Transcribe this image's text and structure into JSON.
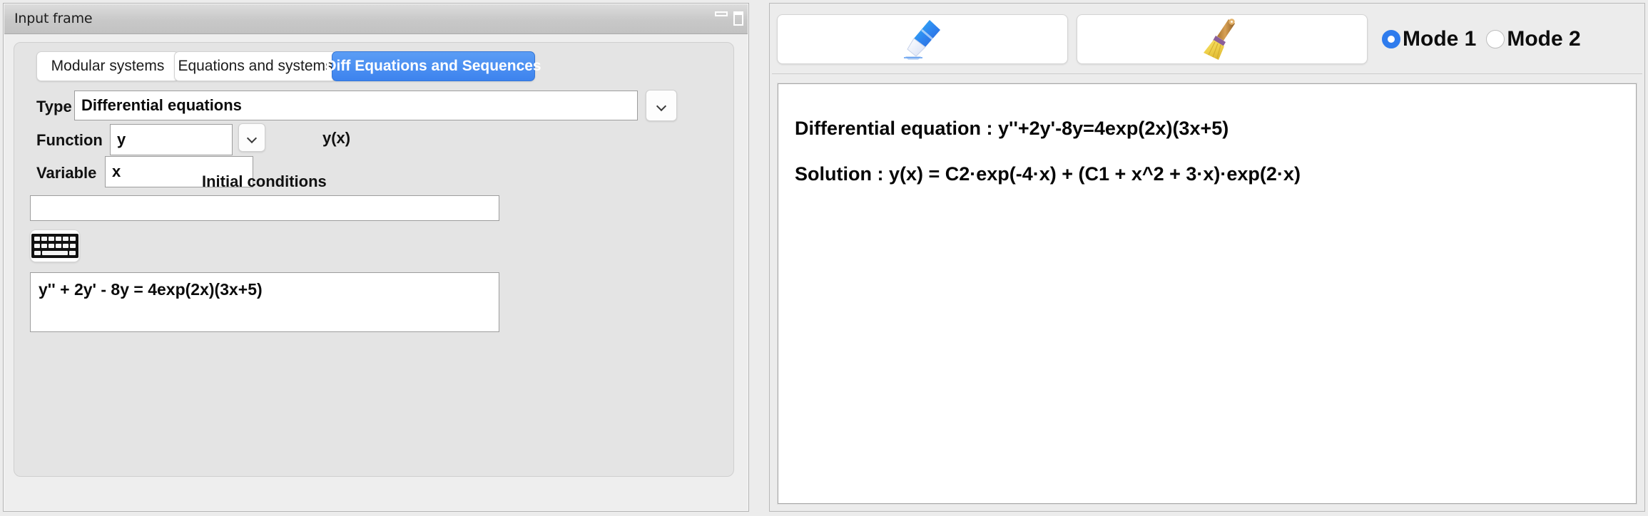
{
  "window": {
    "title": "Input frame",
    "minimize_icon": "minimize-icon",
    "maximize_icon": "maximize-icon"
  },
  "tabs": [
    {
      "label": "Modular systems",
      "active": false
    },
    {
      "label": "Equations and systems",
      "active": false
    },
    {
      "label": "Diff Equations and Sequences",
      "active": true
    }
  ],
  "form": {
    "type_label": "Type",
    "type_value": "Differential equations",
    "type_dropdown_icon": "chevron-down-icon",
    "function_label": "Function",
    "function_value": "y",
    "function_dropdown_icon": "chevron-down-icon",
    "function_notation": "y(x)",
    "variable_label": "Variable",
    "variable_value": "x",
    "initial_conditions_title": "Initial conditions",
    "initial_conditions_value": "",
    "initial_conditions_placeholder": "",
    "keyboard_button_icon": "keyboard-icon",
    "equation_value": "y'' + 2y' - 8y = 4exp(2x)(3x+5)",
    "equation_placeholder": ""
  },
  "toolbar": {
    "buttons": [
      {
        "icon": "eraser-icon",
        "label": ""
      },
      {
        "icon": "broom-icon",
        "label": ""
      }
    ],
    "modes": [
      {
        "label": "Mode 1",
        "selected": true
      },
      {
        "label": "Mode 2",
        "selected": false
      }
    ]
  },
  "result": {
    "lines": [
      "Differential equation :  y''+2y'-8y=4exp(2x)(3x+5)",
      "Solution :  y(x) = C2·exp(-4·x) + (C1 + x^2 + 3·x)·exp(2·x)"
    ]
  },
  "colors": {
    "accent": "#3d83ee",
    "radio_selected": "#2f7ced",
    "window_bg": "#ececec",
    "panel_bg": "#e4e4e4"
  }
}
